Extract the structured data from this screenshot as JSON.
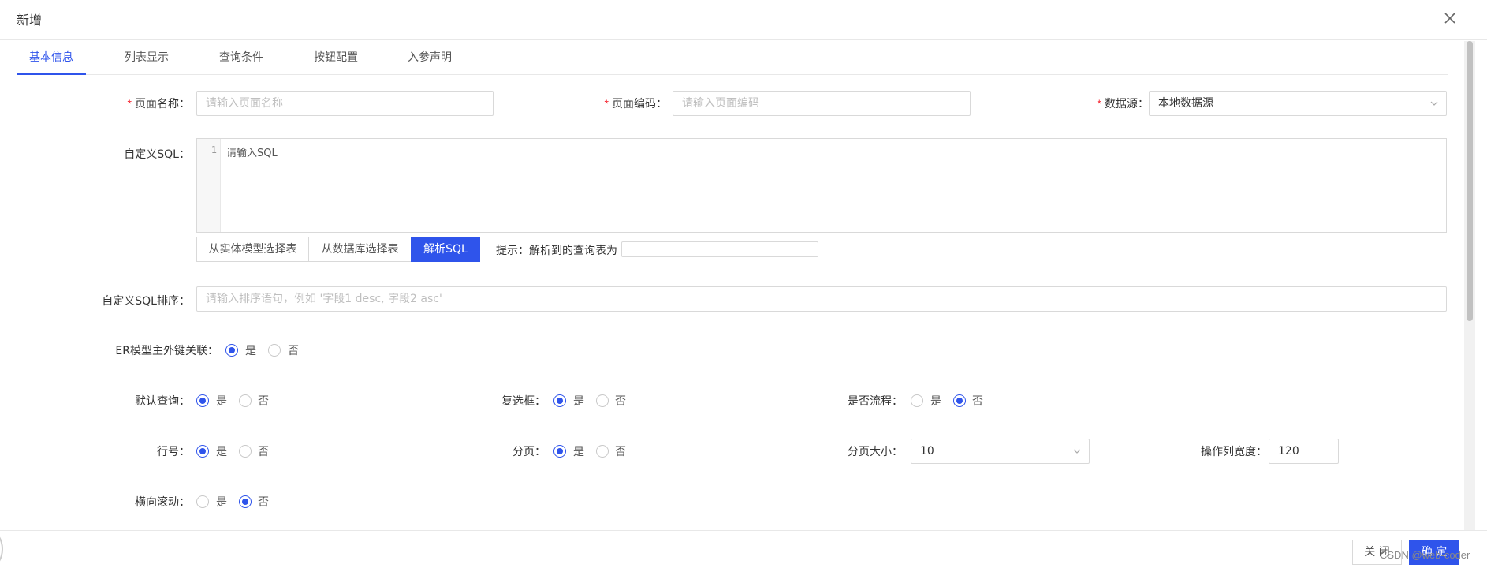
{
  "dialog": {
    "title": "新增"
  },
  "tabs": [
    "基本信息",
    "列表显示",
    "查询条件",
    "按钮配置",
    "入参声明"
  ],
  "form": {
    "page_name": {
      "label": "页面名称：",
      "placeholder": "请输入页面名称"
    },
    "page_code": {
      "label": "页面编码：",
      "placeholder": "请输入页面编码"
    },
    "datasource": {
      "label": "数据源：",
      "value": "本地数据源"
    },
    "custom_sql": {
      "label": "自定义SQL：",
      "line_number": "1",
      "placeholder": "请输入SQL"
    },
    "sql_buttons": {
      "from_entity": "从实体模型选择表",
      "from_db": "从数据库选择表",
      "parse": "解析SQL"
    },
    "hint": {
      "label": "提示：解析到的查询表为"
    },
    "sql_order": {
      "label": "自定义SQL排序：",
      "placeholder": "请输入排序语句，例如 '字段1 desc, 字段2 asc'"
    },
    "er_link": {
      "label": "ER模型主外键关联：",
      "selected": "是"
    },
    "default_query": {
      "label": "默认查询：",
      "selected": "是"
    },
    "checkbox": {
      "label": "复选框：",
      "selected": "是"
    },
    "is_flow": {
      "label": "是否流程：",
      "selected": "否"
    },
    "row_number": {
      "label": "行号：",
      "selected": "是"
    },
    "pagination": {
      "label": "分页：",
      "selected": "是"
    },
    "page_size": {
      "label": "分页大小：",
      "value": "10"
    },
    "action_col_width": {
      "label": "操作列宽度：",
      "value": "120"
    },
    "h_scroll": {
      "label": "横向滚动：",
      "selected": "否"
    },
    "yes": "是",
    "no": "否"
  },
  "footer": {
    "close": "关 闭",
    "confirm": "确 定"
  },
  "watermark": "CSDN @web-coder",
  "colors": {
    "primary": "#2f54eb",
    "required": "#f5222d"
  }
}
